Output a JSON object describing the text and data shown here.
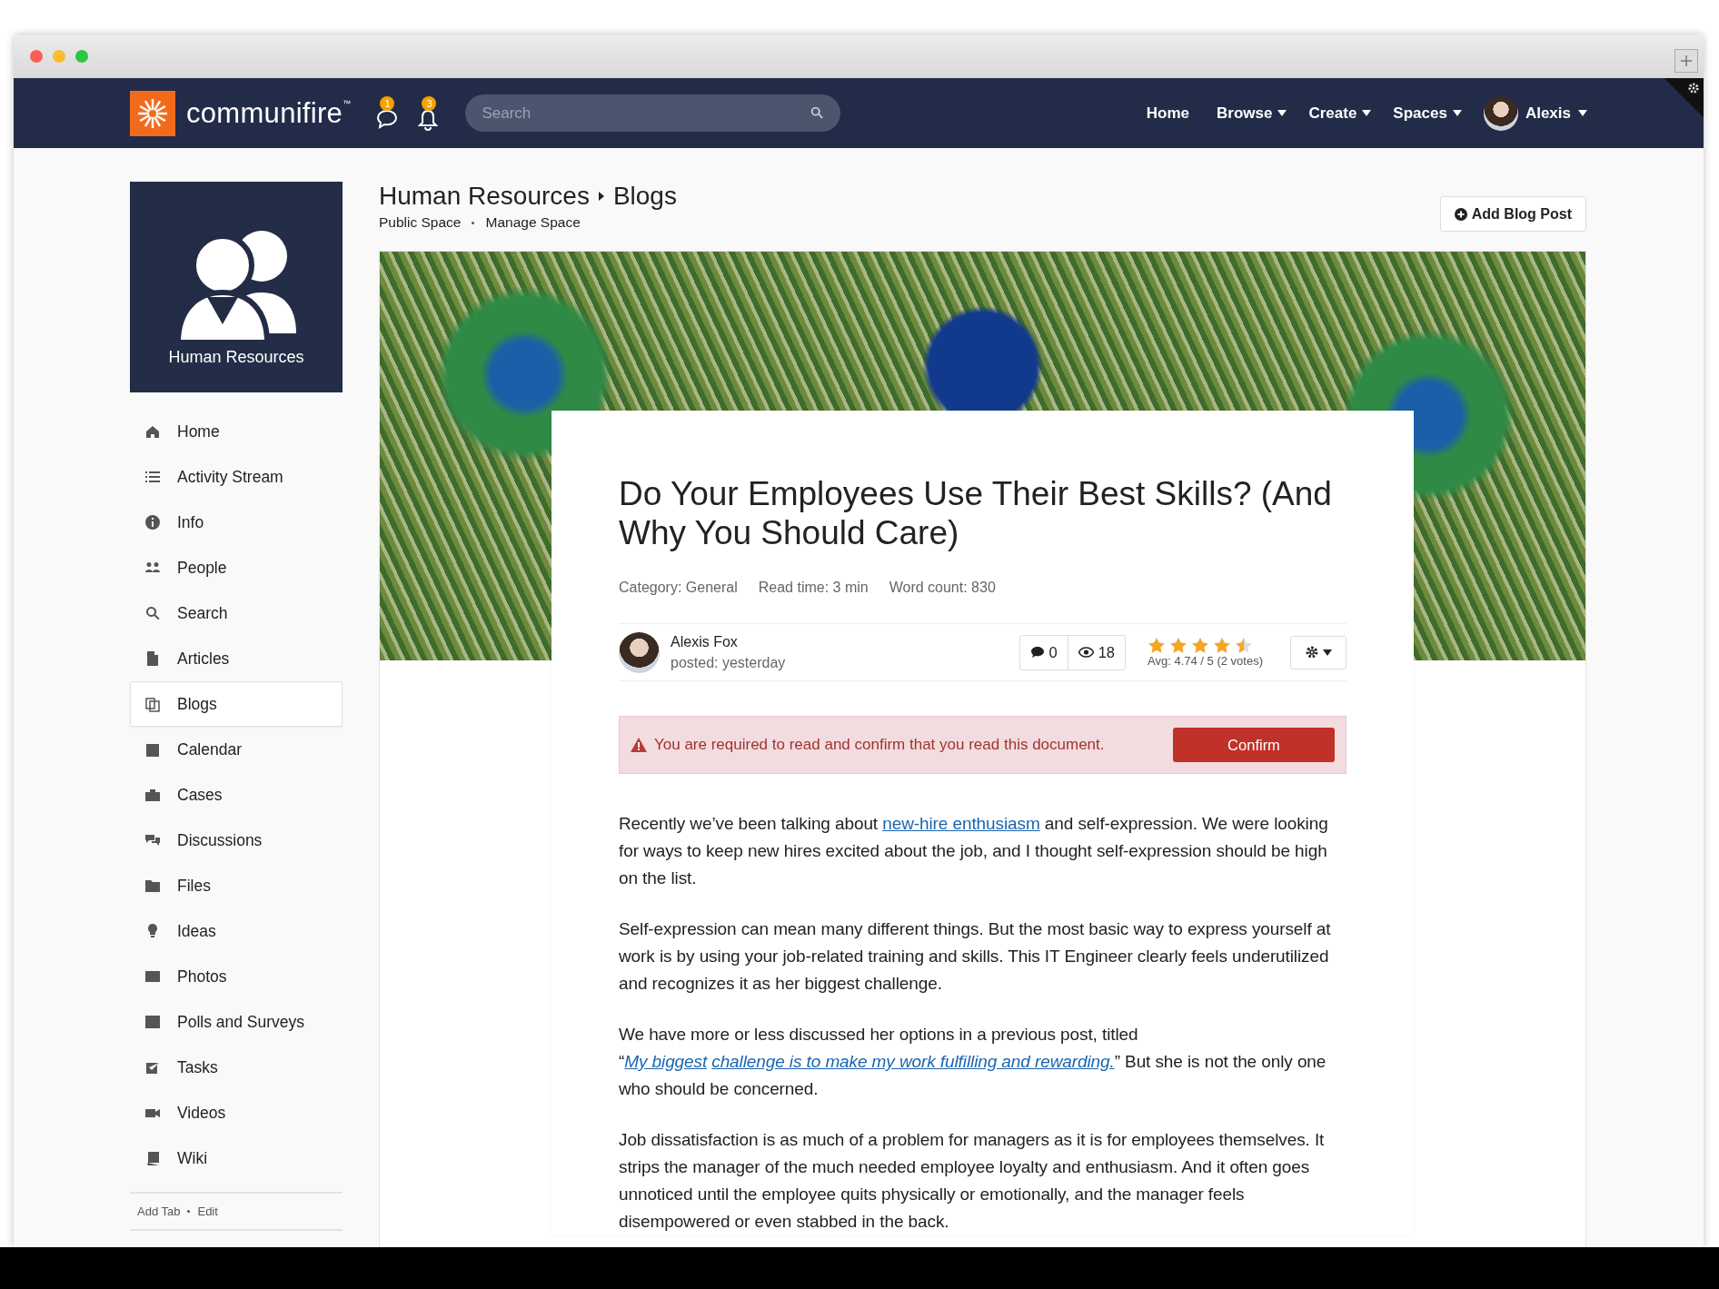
{
  "brand": {
    "name": "communifire",
    "mark": "™"
  },
  "header_icons": [
    {
      "badge": "1"
    },
    {
      "badge": "3"
    }
  ],
  "search": {
    "placeholder": "Search"
  },
  "nav": [
    {
      "label": "Home",
      "dropdown": false
    },
    {
      "label": "Browse",
      "dropdown": true
    },
    {
      "label": "Create",
      "dropdown": true
    },
    {
      "label": "Spaces",
      "dropdown": true
    }
  ],
  "user": {
    "name": "Alexis",
    "dropdown": true
  },
  "space": {
    "name": "Human Resources"
  },
  "sidebar": {
    "items": [
      {
        "label": "Home",
        "selected": false
      },
      {
        "label": "Activity Stream",
        "selected": false
      },
      {
        "label": "Info",
        "selected": false
      },
      {
        "label": "People",
        "selected": false
      },
      {
        "label": "Search",
        "selected": false
      },
      {
        "label": "Articles",
        "selected": false
      },
      {
        "label": "Blogs",
        "selected": true
      },
      {
        "label": "Calendar",
        "selected": false
      },
      {
        "label": "Cases",
        "selected": false
      },
      {
        "label": "Discussions",
        "selected": false
      },
      {
        "label": "Files",
        "selected": false
      },
      {
        "label": "Ideas",
        "selected": false
      },
      {
        "label": "Photos",
        "selected": false
      },
      {
        "label": "Polls and Surveys",
        "selected": false
      },
      {
        "label": "Tasks",
        "selected": false
      },
      {
        "label": "Videos",
        "selected": false
      },
      {
        "label": "Wiki",
        "selected": false
      }
    ],
    "footer_links": [
      "Add Tab",
      "Edit"
    ]
  },
  "breadcrumb": [
    "Human Resources",
    "Blogs"
  ],
  "space_links": [
    "Public Space",
    "Manage Space"
  ],
  "add_button": "Add Blog Post",
  "article": {
    "title": "Do Your Employees Use Their Best Skills? (And Why You Should Care)",
    "meta": [
      "Category: General",
      "Read time: 3 min",
      "Word count: 830"
    ],
    "author": "Alexis Fox",
    "posted": "posted: yesterday",
    "comments": "0",
    "views": "18",
    "stars": 4.5,
    "rating": "Avg: 4.74 / 5 (2 votes)",
    "alert": {
      "text": "You are required to read and confirm that you read this document.",
      "button": "Confirm"
    },
    "paragraphs": [
      [
        {
          "kind": "text",
          "text": "Recently we’ve been talking about "
        },
        {
          "kind": "link",
          "text": "new-hire enthusiasm"
        },
        {
          "kind": "text",
          "text": " and self-expression. We were looking for ways to keep new hires excited about the job, and I thought self-expression should be high on the list."
        }
      ],
      [
        {
          "kind": "text",
          "text": "Self-expression can mean many different things. But the most basic way to express yourself at work is by using your job-related training and skills. This IT Engineer clearly feels underutilized and recognizes it as her biggest challenge."
        }
      ],
      [
        {
          "kind": "text",
          "text": "We have more or less discussed her options in a previous post, titled “"
        },
        {
          "kind": "italic-link",
          "text": "My biggest"
        },
        {
          "kind": "italic-link",
          "text": "challenge is to make my work fulfilling and rewarding."
        },
        {
          "kind": "text",
          "text": "” But she is not the only one who should be concerned."
        }
      ],
      [
        {
          "kind": "text",
          "text": "Job dissatisfaction is as much of a problem for managers as it is for employees themselves. It strips the manager of the much needed employee loyalty and enthusiasm. And it often goes unnoticed until the employee quits physically or emotionally, and the manager feels disempowered or even stabbed in the back."
        }
      ]
    ]
  }
}
